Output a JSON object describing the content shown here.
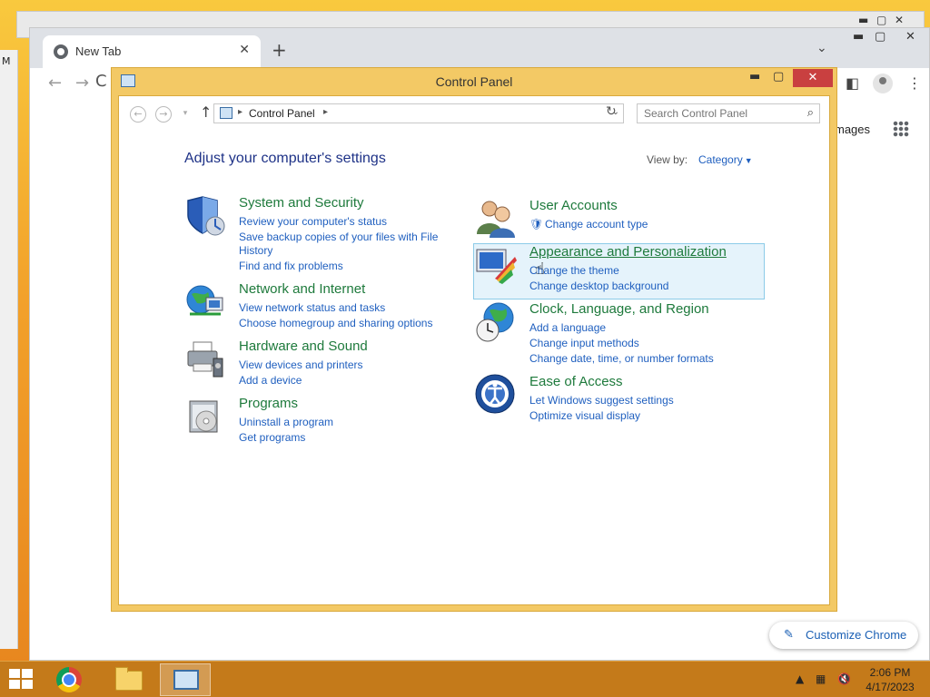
{
  "desktop": {
    "left_fragment_text": "M"
  },
  "chrome": {
    "tab_title": "New Tab",
    "tab_close": "✕",
    "new_tab": "+",
    "images_link": "mages",
    "customize_label": "Customize Chrome"
  },
  "control_panel": {
    "title": "Control Panel",
    "breadcrumb": "Control Panel",
    "search_placeholder": "Search Control Panel",
    "heading": "Adjust your computer's settings",
    "view_by_label": "View by:",
    "view_by_value": "Category",
    "groups": [
      {
        "title": "System and Security",
        "links": [
          "Review your computer's status",
          "Save backup copies of your files with File",
          "History",
          "Find and fix problems"
        ]
      },
      {
        "title": "Network and Internet",
        "links": [
          "View network status and tasks",
          "Choose homegroup and sharing options"
        ]
      },
      {
        "title": "Hardware and Sound",
        "links": [
          "View devices and printers",
          "Add a device"
        ]
      },
      {
        "title": "Programs",
        "links": [
          "Uninstall a program",
          "Get programs"
        ]
      },
      {
        "title": "User Accounts",
        "links": [
          "Change account type"
        ]
      },
      {
        "title": "Appearance and Personalization",
        "links": [
          "Change the theme",
          "Change desktop background"
        ]
      },
      {
        "title": "Clock, Language, and Region",
        "links": [
          "Add a language",
          "Change input methods",
          "Change date, time, or number formats"
        ]
      },
      {
        "title": "Ease of Access",
        "links": [
          "Let Windows suggest settings",
          "Optimize visual display"
        ]
      }
    ]
  },
  "taskbar": {
    "time": "2:06 PM",
    "date": "4/17/2023"
  },
  "colors": {
    "desktop": "#f5a623",
    "window_frame": "#f3c965",
    "link": "#1f5fbf",
    "group_title": "#1e7a3c",
    "heading": "#1e3287",
    "highlight": "#e5f3fb"
  }
}
